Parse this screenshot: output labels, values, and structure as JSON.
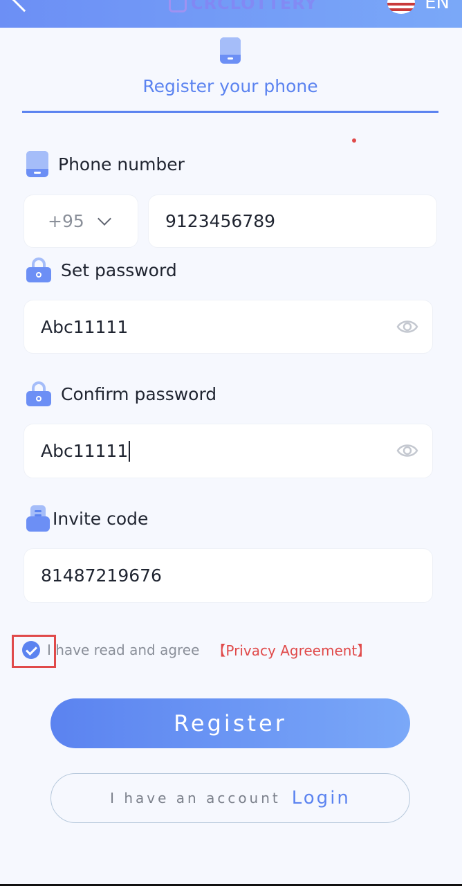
{
  "header": {
    "brand_name": "CRCLOTTERY",
    "language": "EN",
    "icons": {
      "back": "back-arrow-icon",
      "flag": "us-flag-icon"
    }
  },
  "tab": {
    "title": "Register your phone",
    "icon": "phone-icon"
  },
  "form": {
    "phone": {
      "label": "Phone number",
      "country_code": "+95",
      "value": "9123456789"
    },
    "password": {
      "label": "Set password",
      "value": "Abc11111"
    },
    "confirm_password": {
      "label": "Confirm password",
      "value": "Abc11111"
    },
    "invite": {
      "label": "Invite code",
      "value": "81487219676"
    }
  },
  "agreement": {
    "checked": true,
    "text": "I have read and agree",
    "link": "【Privacy Agreement】"
  },
  "actions": {
    "register": "Register",
    "login_prompt": "I have an account",
    "login_link": "Login"
  },
  "colors": {
    "accent": "#5b83f0",
    "link_red": "#e04a4a",
    "background": "#f6f8fe"
  }
}
